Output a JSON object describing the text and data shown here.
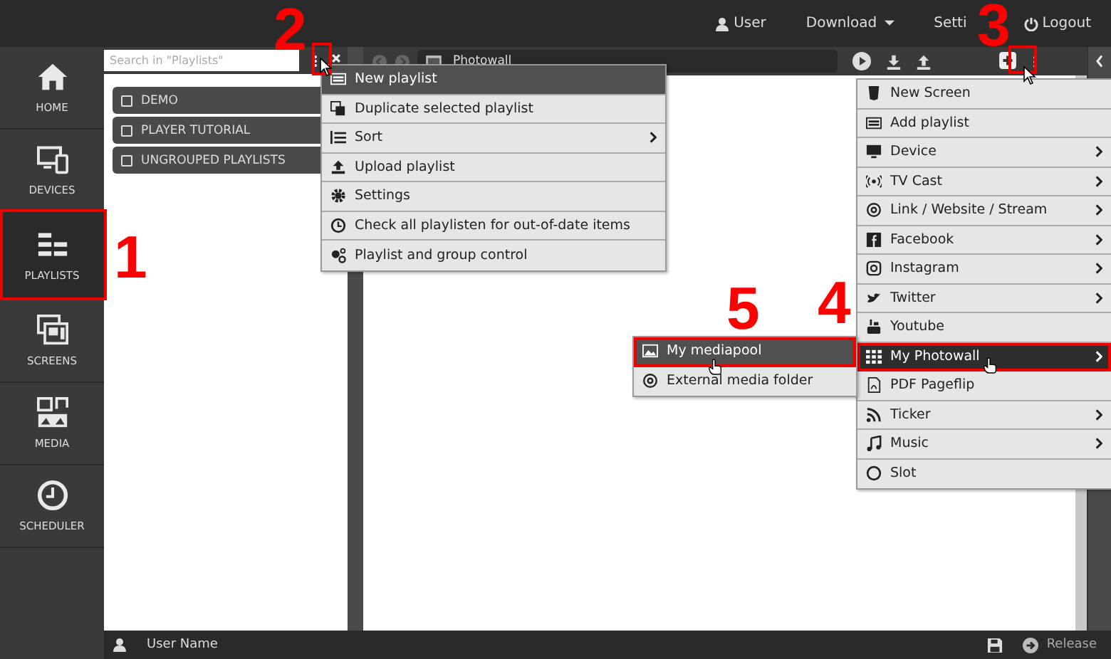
{
  "topbar": {
    "items": [
      {
        "label": "User",
        "kind": "user"
      },
      {
        "label": "Download",
        "kind": "dropdown"
      },
      {
        "label": "Setti",
        "kind": "plain"
      },
      {
        "label": "Logout",
        "kind": "power"
      }
    ]
  },
  "nav": [
    {
      "label": "HOME",
      "kind": "home",
      "selected": false
    },
    {
      "label": "DEVICES",
      "kind": "devices",
      "selected": false
    },
    {
      "label": "PLAYLISTS",
      "kind": "playlists",
      "selected": true
    },
    {
      "label": "SCREENS",
      "kind": "screens",
      "selected": false
    },
    {
      "label": "MEDIA",
      "kind": "media",
      "selected": false
    },
    {
      "label": "SCHEDULER",
      "kind": "clock",
      "selected": false
    }
  ],
  "search": {
    "placeholder": "Search in \"Playlists\""
  },
  "playlists": [
    {
      "label": "DEMO"
    },
    {
      "label": "PLAYER TUTORIAL"
    },
    {
      "label": "UNGROUPED PLAYLISTS"
    }
  ],
  "editor": {
    "title": "Photowall"
  },
  "playlist_menu": [
    {
      "label": "New playlist",
      "kind": "list",
      "submenu": false,
      "selected": true
    },
    {
      "label": "Duplicate selected playlist",
      "kind": "copy",
      "submenu": false,
      "selected": false
    },
    {
      "label": "Sort",
      "kind": "sort",
      "submenu": true,
      "selected": false
    },
    {
      "label": "Upload playlist",
      "kind": "upload",
      "submenu": false,
      "selected": false
    },
    {
      "label": "Settings",
      "kind": "gear",
      "submenu": false,
      "selected": false
    },
    {
      "label": "Check all playlisten for out-of-date items",
      "kind": "clock",
      "submenu": false,
      "selected": false
    },
    {
      "label": "Playlist and group control",
      "kind": "gears",
      "submenu": false,
      "selected": false
    }
  ],
  "add_menu": [
    {
      "label": "New Screen",
      "kind": "html",
      "submenu": false,
      "selected": false
    },
    {
      "label": "Add playlist",
      "kind": "list",
      "submenu": false,
      "selected": false
    },
    {
      "label": "Device",
      "kind": "monitor",
      "submenu": true,
      "selected": false
    },
    {
      "label": "TV Cast",
      "kind": "cast",
      "submenu": true,
      "selected": false
    },
    {
      "label": "Link / Website / Stream",
      "kind": "at",
      "submenu": true,
      "selected": false
    },
    {
      "label": "Facebook",
      "kind": "facebook",
      "submenu": true,
      "selected": false
    },
    {
      "label": "Instagram",
      "kind": "camera",
      "submenu": true,
      "selected": false
    },
    {
      "label": "Twitter",
      "kind": "bird",
      "submenu": true,
      "selected": false
    },
    {
      "label": "Youtube",
      "kind": "youtube",
      "submenu": false,
      "selected": false
    },
    {
      "label": "My Photowall",
      "kind": "grid",
      "submenu": true,
      "selected": true
    },
    {
      "label": "PDF Pageflip",
      "kind": "pdf",
      "submenu": false,
      "selected": false
    },
    {
      "label": "Ticker",
      "kind": "rss",
      "submenu": true,
      "selected": false
    },
    {
      "label": "Music",
      "kind": "music",
      "submenu": true,
      "selected": false
    },
    {
      "label": "Slot",
      "kind": "ring",
      "submenu": false,
      "selected": false
    }
  ],
  "media_submenu": [
    {
      "label": "My mediapool",
      "kind": "image",
      "selected": true
    },
    {
      "label": "External media folder",
      "kind": "at",
      "selected": false
    }
  ],
  "status_bar": {
    "user": "User Name",
    "release": "Release"
  },
  "annotations": [
    {
      "label": "1"
    },
    {
      "label": "2"
    },
    {
      "label": "3"
    },
    {
      "label": "4"
    },
    {
      "label": "5"
    }
  ]
}
